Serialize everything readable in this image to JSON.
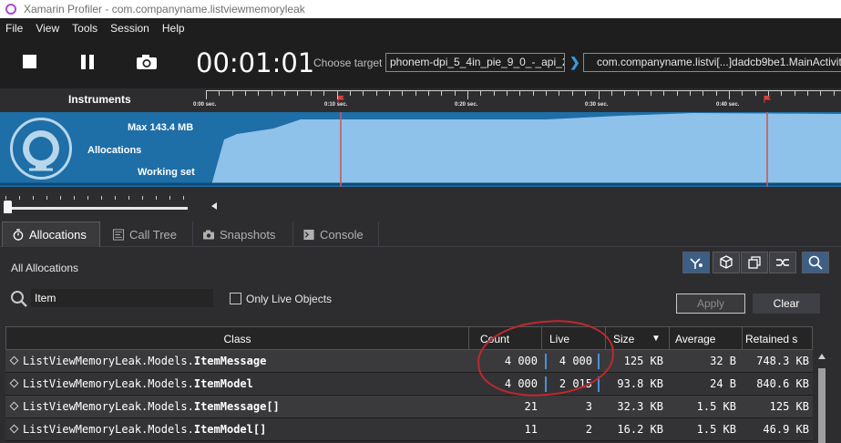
{
  "window": {
    "title": "Xamarin Profiler - com.companyname.listviewmemoryleak"
  },
  "menu": {
    "items": [
      "File",
      "View",
      "Tools",
      "Session",
      "Help"
    ]
  },
  "toolbar": {
    "timer": "00:01:01",
    "choose_target_label": "Choose target",
    "device": "phonem-dpi_5_4in_pie_9_0_-_api_28",
    "app": "com.companyname.listvi[...]dadcb9be1.MainActivity"
  },
  "instruments": {
    "label": "Instruments",
    "ticks": [
      "0:00 sec.",
      "0:10 sec.",
      "0:20 sec.",
      "0:30 sec.",
      "0:40 sec."
    ]
  },
  "allocations_graph": {
    "max_label": "Max 143.4 MB",
    "name": "Allocations",
    "mode": "Working set",
    "fill_color": "#8ec2ea",
    "background_color": "#1e6ea7"
  },
  "tabs": [
    {
      "label": "Allocations",
      "icon": "stopwatch-icon",
      "active": true
    },
    {
      "label": "Call Tree",
      "icon": "calltree-icon",
      "active": false
    },
    {
      "label": "Snapshots",
      "icon": "camera-icon",
      "active": false
    },
    {
      "label": "Console",
      "icon": "console-icon",
      "active": false
    }
  ],
  "panel": {
    "title": "All Allocations",
    "search_value": "Item",
    "live_only_label": "Only Live Objects",
    "apply_label": "Apply",
    "clear_label": "Clear"
  },
  "table": {
    "columns": [
      "Class",
      "Count",
      "Live",
      "Size",
      "Average",
      "Retained s"
    ],
    "rows": [
      {
        "prefix": "ListViewMemoryLeak.Models.",
        "name": "ItemMessage",
        "count": "4 000",
        "live": "4 000",
        "size": "125 KB",
        "average": "32 B",
        "retained": "748.3 KB"
      },
      {
        "prefix": "ListViewMemoryLeak.Models.",
        "name": "ItemModel",
        "count": "4 000",
        "live": "2 015",
        "size": "93.8 KB",
        "average": "24 B",
        "retained": "840.6 KB"
      },
      {
        "prefix": "ListViewMemoryLeak.Models.",
        "name": "ItemMessage[]",
        "count": "21",
        "live": "3",
        "size": "32.3 KB",
        "average": "1.5 KB",
        "retained": "125 KB"
      },
      {
        "prefix": "ListViewMemoryLeak.Models.",
        "name": "ItemModel[]",
        "count": "11",
        "live": "2",
        "size": "16.2 KB",
        "average": "1.5 KB",
        "retained": "46.9 KB"
      }
    ]
  },
  "colors": {
    "accent": "#3a9ad9",
    "annotation": "#c0282e",
    "live_bar": "#4a8fd6"
  }
}
